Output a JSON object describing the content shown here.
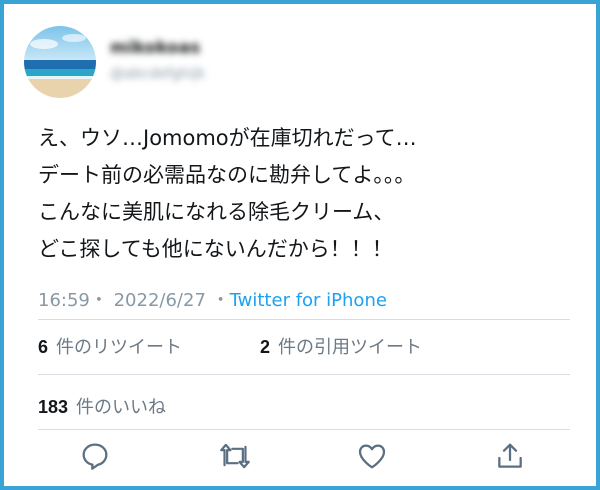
{
  "user": {
    "name": "mikokoas",
    "handle": "@abcdefghijk"
  },
  "tweet": {
    "lines": [
      "え、ウソ…Jomomoが在庫切れだって…",
      "デート前の必需品なのに勘弁してよ。。。",
      "こんなに美肌になれる除毛クリーム、",
      "どこ探しても他にないんだから！！！"
    ],
    "time": "16:59",
    "date": "2022/6/27",
    "source": "Twitter for iPhone"
  },
  "stats": {
    "retweets_count": "6",
    "retweets_label": "件のリツイート",
    "quotes_count": "2",
    "quotes_label": "件の引用ツイート",
    "likes_count": "183",
    "likes_label": "件のいいね"
  },
  "actions": {
    "reply_icon": "reply-icon",
    "retweet_icon": "retweet-icon",
    "like_icon": "heart-icon",
    "share_icon": "share-icon"
  },
  "colors": {
    "frame": "#3aa3d6",
    "link": "#1da1f2",
    "icon": "#5b6f82",
    "muted": "#8899a6"
  }
}
